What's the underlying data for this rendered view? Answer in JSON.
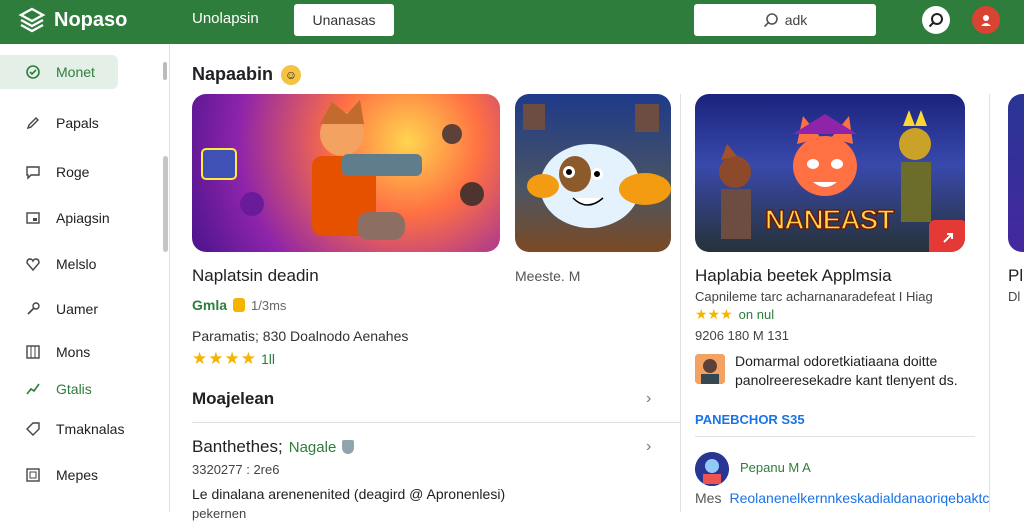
{
  "header": {
    "logo": "Nopaso",
    "tab": "Unolapsin",
    "button": "Unanasas",
    "search_placeholder": "adk"
  },
  "sidebar": {
    "items": [
      {
        "label": "Monet",
        "icon": "circle-check-icon"
      },
      {
        "label": "Papals",
        "icon": "pen-icon"
      },
      {
        "label": "Roge",
        "icon": "message-icon"
      },
      {
        "label": "Apiagsin",
        "icon": "window-icon"
      },
      {
        "label": "Melslo",
        "icon": "heart-icon"
      },
      {
        "label": "Uamer",
        "icon": "tool-icon"
      },
      {
        "label": "Mons",
        "icon": "grid-icon"
      },
      {
        "label": "Gtalis",
        "icon": "chart-icon"
      },
      {
        "label": "Tmaknalas",
        "icon": "tag-icon"
      },
      {
        "label": "Mepes",
        "icon": "box-icon"
      }
    ]
  },
  "main": {
    "section_title": "Napaabin",
    "card1": {
      "title": "Naplatsin deadin",
      "developer": "Gmla",
      "meta": "1/3ms",
      "desc": "Paramatis; 830 Doalnodo Aenahes",
      "rating": "1ll"
    },
    "card2": {
      "title": "Meeste. M"
    },
    "list_title": "Moajelean",
    "list_item": {
      "title": "Banthethes;",
      "tag": "Nagale",
      "meta": "3320277 : 2re6",
      "desc": "Le dinalana arenenenited (deagird @ Apronenlesi)",
      "desc2": "pekernen"
    },
    "card3": {
      "title": "Haplabia beetek Applmsia",
      "banner_text": "NANEAST",
      "subtitle": "Capnileme tarc acharnanaradefeat I Hiag",
      "rating_text": "on nul",
      "meta": "9206 180 M 131",
      "review": "Domarmal odoretkiatiaana doitte panolreeresekadre kant tlenyent ds.",
      "link": "PANEBCHOR S35",
      "user2": "Pepanu M A",
      "footer_label": "Mes",
      "footer_link": "Reolanenelkernnkeskadialdanaoriqebaktc"
    },
    "card4": {
      "title": "Pl",
      "subtitle": "Dl"
    }
  },
  "colors": {
    "brand": "#2e7d3c",
    "accent_red": "#e53935",
    "star": "#f4b400",
    "link": "#1a73e8"
  }
}
